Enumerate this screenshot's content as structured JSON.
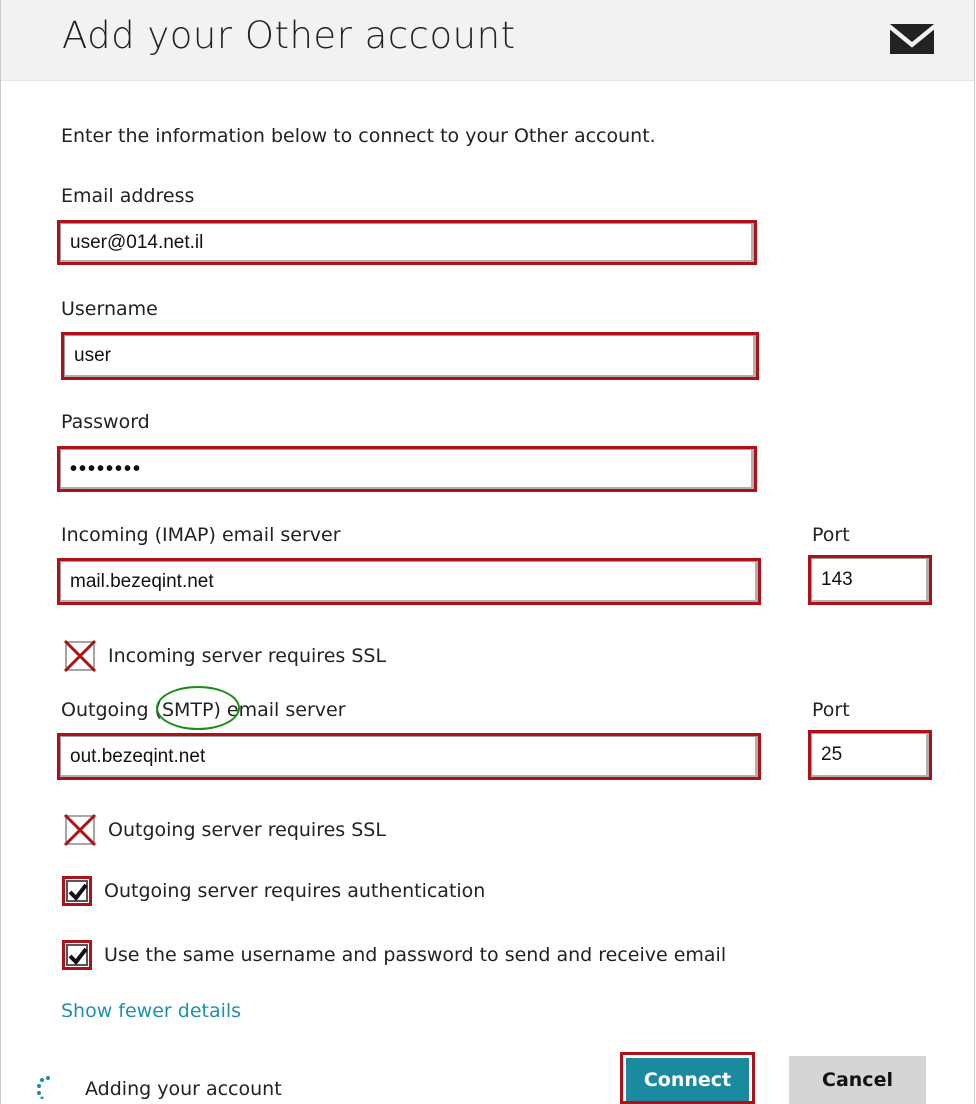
{
  "header": {
    "title": "Add your Other account",
    "icon": "mail-icon"
  },
  "intro": "Enter the information below to connect to your Other account.",
  "fields": {
    "email": {
      "label": "Email address",
      "value": "user@014.net.il"
    },
    "username": {
      "label": "Username",
      "value": "user"
    },
    "password": {
      "label": "Password",
      "value": "••••••••"
    },
    "incoming": {
      "label": "Incoming (IMAP) email server",
      "value": "mail.bezeqint.net"
    },
    "incoming_port": {
      "label": "Port",
      "value": "143"
    },
    "outgoing": {
      "label": "Outgoing (SMTP) email server",
      "value": "out.bezeqint.net"
    },
    "outgoing_port": {
      "label": "Port",
      "value": "25"
    }
  },
  "options": {
    "incoming_ssl": {
      "label": "Incoming server requires SSL",
      "state": "unchecked"
    },
    "outgoing_ssl": {
      "label": "Outgoing server requires SSL",
      "state": "unchecked"
    },
    "outgoing_auth": {
      "label": "Outgoing server requires authentication",
      "state": "checked"
    },
    "same_credentials": {
      "label": "Use the same username and password to send and receive email",
      "state": "checked"
    }
  },
  "show_fewer_link": "Show fewer details",
  "status": "Adding your account",
  "buttons": {
    "connect": "Connect",
    "cancel": "Cancel"
  },
  "colors": {
    "highlight": "#b01018",
    "accent": "#1b8aa0",
    "link": "#1e8fb0",
    "annotation": "#1a8c1a"
  }
}
